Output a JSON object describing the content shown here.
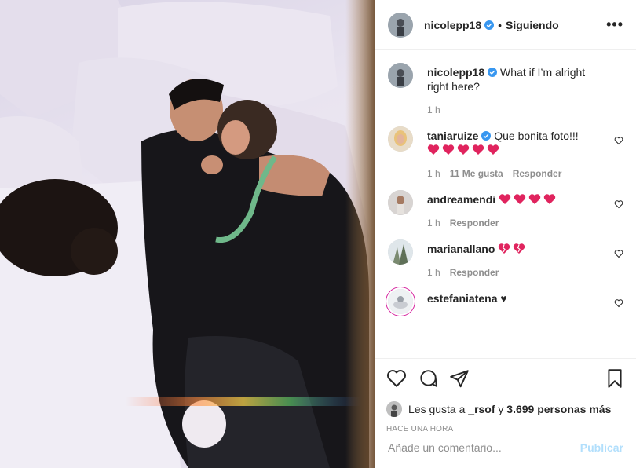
{
  "header": {
    "username": "nicolepp18",
    "separator": "•",
    "follow_label": "Siguiendo",
    "more_label": "•••"
  },
  "caption": {
    "username": "nicolepp18",
    "text": "What if I’m alright right here?",
    "time": "1 h"
  },
  "comments": [
    {
      "username": "taniaruize",
      "text": "Que bonita foto!!!",
      "time": "1 h",
      "likes": "11 Me gusta",
      "reply": "Responder",
      "heart_count": 5
    },
    {
      "username": "andreamendi",
      "text": "",
      "time": "1 h",
      "reply": "Responder",
      "heart_count": 4
    },
    {
      "username": "marianallano",
      "text": "",
      "time": "1 h",
      "reply": "Responder",
      "heart_count": 2
    },
    {
      "username": "estefaniatena",
      "text": "♥"
    }
  ],
  "likes": {
    "prefix": "Les gusta a",
    "user": "_rsof",
    "connector": "y",
    "count": "3.699 personas más"
  },
  "timestamp": "HACE UNA HORA",
  "add_comment": {
    "placeholder": "Añade un comentario...",
    "publish_label": "Publicar"
  },
  "colors": {
    "verified": "#3897f0",
    "heart_red": "#e0245e",
    "publish_disabled": "#b2dffc",
    "muted": "#8e8e8e"
  },
  "icons": [
    "verified-icon",
    "more-icon",
    "heart-icon",
    "comment-icon",
    "share-icon",
    "save-icon",
    "red-heart-emoji",
    "broken-heart-emoji"
  ]
}
